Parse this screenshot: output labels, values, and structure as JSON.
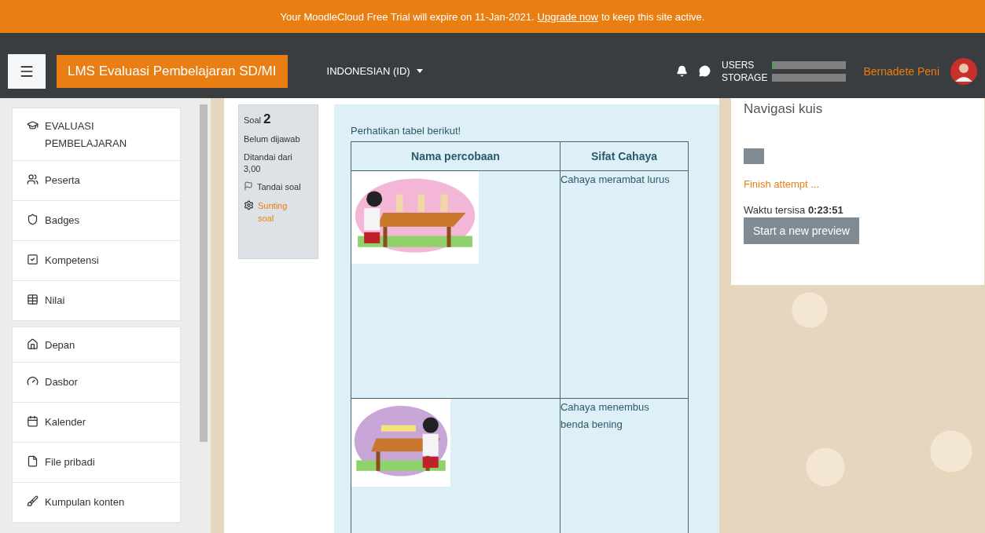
{
  "banner": {
    "text_before": "Your MoodleCloud Free Trial will expire on 11-Jan-2021.",
    "link": "Upgrade now",
    "text_after": "to keep this site active."
  },
  "navbar": {
    "site_name": "LMS Evaluasi Pembelajaran SD/MI",
    "language": "INDONESIAN (ID)",
    "usage": [
      {
        "label": "USERS",
        "level": 0.02
      },
      {
        "label": "STORAGE"
      }
    ],
    "user_name": "Bernadete Peni"
  },
  "sidebar": {
    "groups": [
      {
        "items": [
          {
            "label": "EVALUASI PEMBELAJARAN"
          },
          {
            "label": "Peserta"
          },
          {
            "label": "Badges"
          },
          {
            "label": "Kompetensi"
          },
          {
            "label": "Nilai"
          }
        ]
      },
      {
        "items": [
          {
            "label": "Depan"
          },
          {
            "label": "Dasbor"
          },
          {
            "label": "Kalender"
          },
          {
            "label": "File pribadi"
          },
          {
            "label": "Kumpulan konten"
          }
        ]
      }
    ]
  },
  "question_info": {
    "label": "Soal",
    "number": "2",
    "state": "Belum dijawab",
    "marks": "Ditandai dari 3,00",
    "flag": "Tandai soal",
    "edit": "Sunting soal"
  },
  "question": {
    "intro": "Perhatikan tabel berikut!",
    "columns": [
      "Nama percobaan",
      "Sifat Cahaya"
    ],
    "rows": [
      {
        "text": "Cahaya merambat lurus"
      },
      {
        "text": "Cahaya menembus benda bening"
      }
    ]
  },
  "quiz_nav": {
    "title": "Navigasi kuis",
    "finish": "Finish attempt ...",
    "time_label": "Waktu tersisa",
    "time_value": "0:23:51",
    "button": "Start a new preview"
  }
}
